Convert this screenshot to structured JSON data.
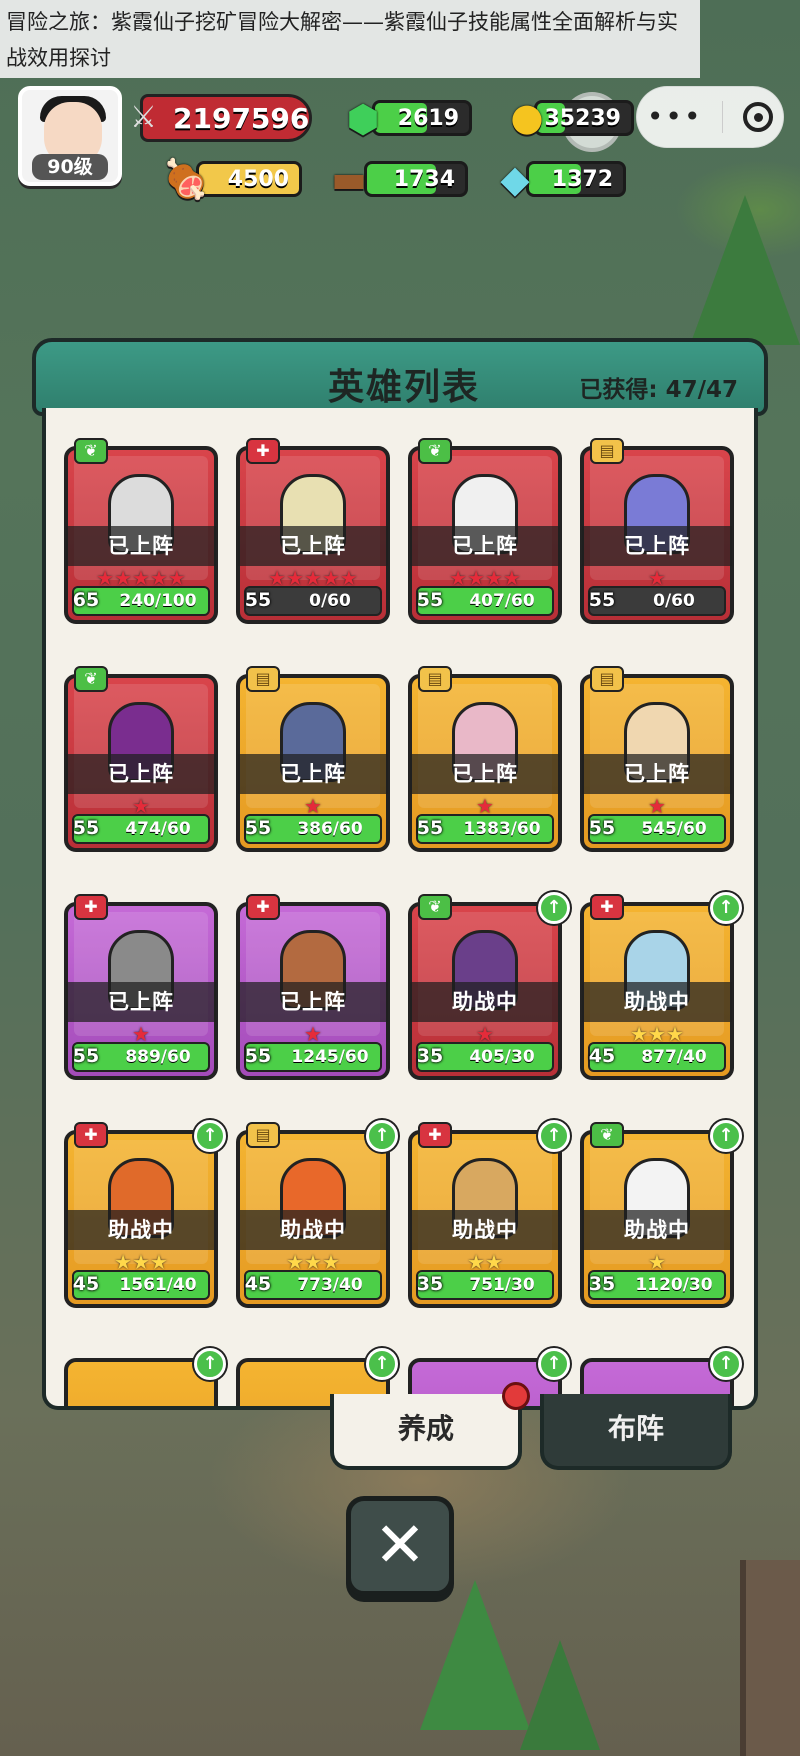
{
  "article_title": "冒险之旅：紫霞仙子挖矿冒险大解密——紫霞仙子技能属性全面解析与实战效用探讨",
  "player": {
    "level_label": "90级",
    "combat_power": "2197596"
  },
  "resources": [
    {
      "icon": "green-gem-icon",
      "value": "2619",
      "fill": 0.55,
      "color": "#4ccf48"
    },
    {
      "icon": "gold-coin-icon",
      "value": "35239",
      "fill": 0.3,
      "color": "#4ccf48"
    },
    {
      "icon": "meat-icon",
      "value": "4500",
      "fill": 1.0,
      "color": "#f2c84a"
    },
    {
      "icon": "wood-log-icon",
      "value": "1734",
      "fill": 0.7,
      "color": "#4ccf48"
    },
    {
      "icon": "crystal-icon",
      "value": "1372",
      "fill": 0.55,
      "color": "#4ccf48"
    }
  ],
  "panel": {
    "title": "英雄列表",
    "count": "已获得: 47/47"
  },
  "heroes": [
    {
      "type": "leaf",
      "rarity": "red",
      "status": "已上阵",
      "stars": 5,
      "star_color": "red",
      "level": "65",
      "progress": "240/100",
      "fill": 1.0,
      "upgrade": false
    },
    {
      "type": "cross",
      "rarity": "red",
      "status": "已上阵",
      "stars": 5,
      "star_color": "red",
      "level": "55",
      "progress": "0/60",
      "fill": 0.0,
      "upgrade": false
    },
    {
      "type": "leaf",
      "rarity": "red",
      "status": "已上阵",
      "stars": 4,
      "star_color": "red",
      "level": "55",
      "progress": "407/60",
      "fill": 1.0,
      "upgrade": false
    },
    {
      "type": "book",
      "rarity": "red",
      "status": "已上阵",
      "stars": 1,
      "star_color": "red",
      "level": "55",
      "progress": "0/60",
      "fill": 0.0,
      "upgrade": false
    },
    {
      "type": "leaf",
      "rarity": "red",
      "status": "已上阵",
      "stars": 1,
      "star_color": "red",
      "level": "55",
      "progress": "474/60",
      "fill": 1.0,
      "upgrade": false
    },
    {
      "type": "book",
      "rarity": "gold",
      "status": "已上阵",
      "stars": 1,
      "star_color": "red",
      "level": "55",
      "progress": "386/60",
      "fill": 1.0,
      "upgrade": false
    },
    {
      "type": "book",
      "rarity": "gold",
      "status": "已上阵",
      "stars": 1,
      "star_color": "red",
      "level": "55",
      "progress": "1383/60",
      "fill": 1.0,
      "upgrade": false
    },
    {
      "type": "book",
      "rarity": "gold",
      "status": "已上阵",
      "stars": 1,
      "star_color": "red",
      "level": "55",
      "progress": "545/60",
      "fill": 1.0,
      "upgrade": false
    },
    {
      "type": "cross",
      "rarity": "purple",
      "status": "已上阵",
      "stars": 1,
      "star_color": "red",
      "level": "55",
      "progress": "889/60",
      "fill": 1.0,
      "upgrade": false
    },
    {
      "type": "cross",
      "rarity": "purple",
      "status": "已上阵",
      "stars": 1,
      "star_color": "red",
      "level": "55",
      "progress": "1245/60",
      "fill": 1.0,
      "upgrade": false
    },
    {
      "type": "leaf",
      "rarity": "red",
      "status": "助战中",
      "stars": 1,
      "star_color": "red",
      "level": "35",
      "progress": "405/30",
      "fill": 1.0,
      "upgrade": true
    },
    {
      "type": "cross",
      "rarity": "gold",
      "status": "助战中",
      "stars": 3,
      "star_color": "gold",
      "level": "45",
      "progress": "877/40",
      "fill": 1.0,
      "upgrade": true
    },
    {
      "type": "cross",
      "rarity": "gold",
      "status": "助战中",
      "stars": 3,
      "star_color": "gold",
      "level": "45",
      "progress": "1561/40",
      "fill": 1.0,
      "upgrade": true
    },
    {
      "type": "book",
      "rarity": "gold",
      "status": "助战中",
      "stars": 3,
      "star_color": "gold",
      "level": "45",
      "progress": "773/40",
      "fill": 1.0,
      "upgrade": true
    },
    {
      "type": "cross",
      "rarity": "gold",
      "status": "助战中",
      "stars": 2,
      "star_color": "gold",
      "level": "35",
      "progress": "751/30",
      "fill": 1.0,
      "upgrade": true
    },
    {
      "type": "leaf",
      "rarity": "gold",
      "status": "助战中",
      "stars": 1,
      "star_color": "gold",
      "level": "35",
      "progress": "1120/30",
      "fill": 1.0,
      "upgrade": true
    }
  ],
  "tabs": {
    "train": "养成",
    "formation": "布阵"
  },
  "close_button": "✕",
  "colors": {
    "panel_header": "#3d9a86",
    "card_red": "#d9444b",
    "card_gold": "#f4b431",
    "card_purple": "#c56ad7",
    "progress_green": "#4ccf48"
  }
}
